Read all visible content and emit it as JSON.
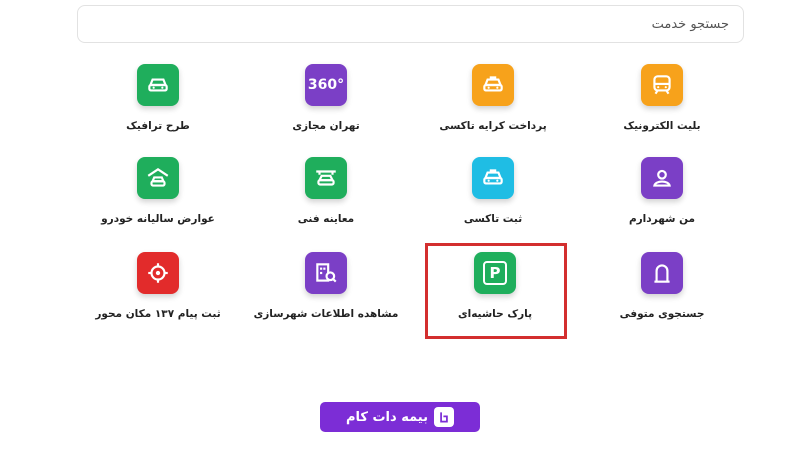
{
  "search": {
    "placeholder": "جستجو خدمت"
  },
  "services": [
    {
      "label": "بلیت الکترونیک",
      "icon": "ticket-icon",
      "color": "#f7a21b"
    },
    {
      "label": "پرداخت کرایه تاکسی",
      "icon": "taxi-payment-icon",
      "color": "#f7a21b"
    },
    {
      "label": "تهران مجازی",
      "icon": "360-icon",
      "icon_text": "360°",
      "color": "#7b3fc6"
    },
    {
      "label": "طرح ترافیک",
      "icon": "car-icon",
      "color": "#1fae5c"
    },
    {
      "label": "من شهردارم",
      "icon": "user-icon",
      "color": "#7b3fc6"
    },
    {
      "label": "ثبت تاکسی",
      "icon": "taxi-icon",
      "color": "#1fbde4"
    },
    {
      "label": "معاینه فنی",
      "icon": "car-inspection-icon",
      "color": "#1fae5c"
    },
    {
      "label": "عوارض سالیانه خودرو",
      "icon": "garage-car-icon",
      "color": "#1fae5c"
    },
    {
      "label": "جستجوی متوفی",
      "icon": "tombstone-icon",
      "color": "#7b3fc6"
    },
    {
      "label": "پارک حاشیه‌ای",
      "icon": "parking-icon",
      "icon_text": "P",
      "color": "#1fae5c"
    },
    {
      "label": "مشاهده اطلاعات شهرسازی",
      "icon": "building-search-icon",
      "color": "#7b3fc6"
    },
    {
      "label": "ثبت پیام ۱۳۷ مکان محور",
      "icon": "location-target-icon",
      "color": "#e22b2b"
    }
  ],
  "logo": {
    "text": "بیمه دات کام",
    "color": "#7c2dd6"
  },
  "highlight_color": "#d32f2f"
}
